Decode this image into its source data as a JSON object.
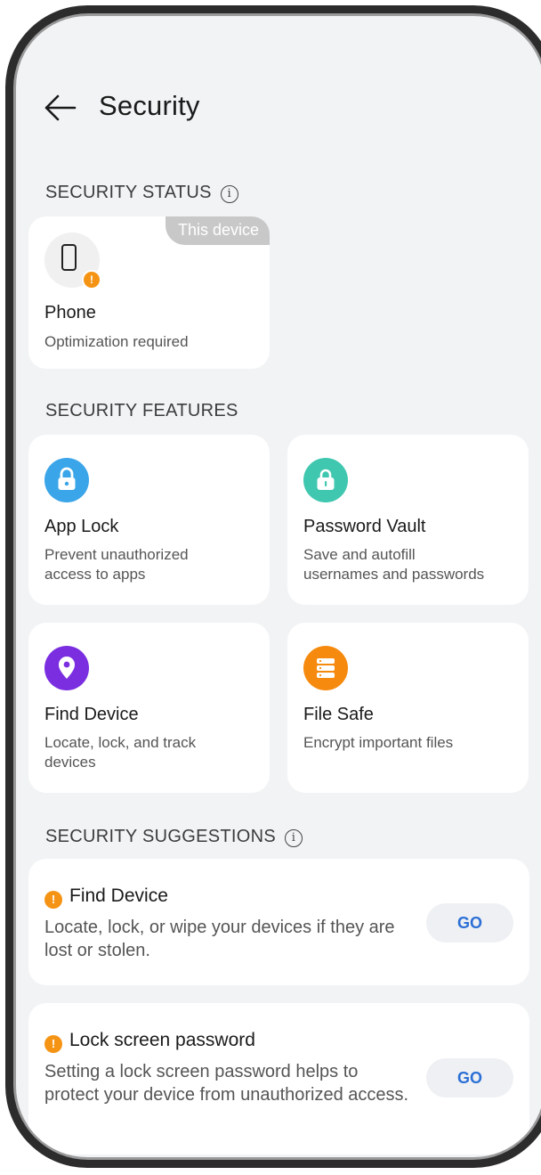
{
  "header": {
    "title": "Security",
    "back_icon": "arrow-left-icon"
  },
  "security_status": {
    "section_title": "SECURITY STATUS",
    "info_icon": "info-icon",
    "info_glyph": "i",
    "device_card": {
      "badge": "This device",
      "icon": "phone-icon",
      "warning_glyph": "!",
      "title": "Phone",
      "status": "Optimization required"
    }
  },
  "security_features": {
    "section_title": "SECURITY FEATURES",
    "items": [
      {
        "icon": "lock-icon",
        "color": "#3aa5e8",
        "title": "App Lock",
        "desc_line1": "Prevent unauthorized",
        "desc_line2": "access to apps"
      },
      {
        "icon": "password-vault-icon",
        "color": "#3fc7b0",
        "title": "Password Vault",
        "desc_line1": "Save and autofill",
        "desc_line2": "usernames and passwords"
      },
      {
        "icon": "location-pin-icon",
        "color": "#7a2ee0",
        "title": "Find Device",
        "desc_line1": "Locate, lock, and track",
        "desc_line2": "devices"
      },
      {
        "icon": "file-safe-icon",
        "color": "#f68a0f",
        "title": "File Safe",
        "desc_line1": "Encrypt important files",
        "desc_line2": ""
      }
    ]
  },
  "security_suggestions": {
    "section_title": "SECURITY SUGGESTIONS",
    "info_glyph": "i",
    "warning_glyph": "!",
    "items": [
      {
        "title": "Find Device",
        "desc": "Locate, lock, or wipe your devices if they are lost or stolen.",
        "button": "GO"
      },
      {
        "title": "Lock screen password",
        "desc": "Setting a lock screen password helps to protect your device from unauthorized access.",
        "button": "GO"
      }
    ]
  }
}
